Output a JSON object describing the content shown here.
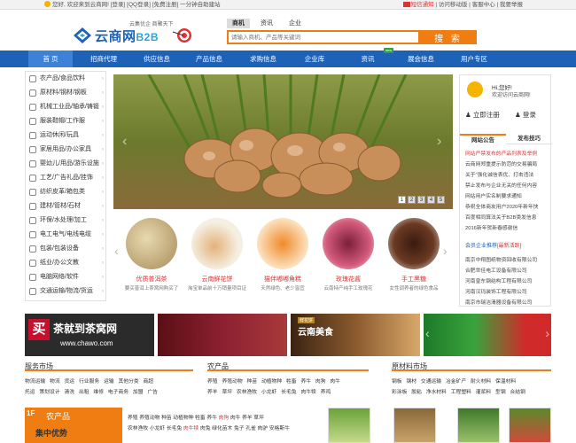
{
  "topbar": {
    "greeting": "您好, 欢迎来到云商网!",
    "login": "[登录]",
    "qq_login": "[QQ登录]",
    "register": "[免费注册]",
    "promo": "一分钟自助建站",
    "mail": "短信通知",
    "mobile": "访问移动版",
    "service": "客服中心",
    "report": "我要举报"
  },
  "logo": {
    "slogan": "云集优企 商聚天下",
    "name": "云商网",
    "b2b": "B2B"
  },
  "search": {
    "tabs": [
      "商机",
      "资讯",
      "企业"
    ],
    "placeholder": "请输入商机、产品等关键词",
    "button": "搜 索"
  },
  "nav": {
    "items": [
      "首 页",
      "招商代理",
      "供应信息",
      "产品信息",
      "求购信息",
      "企业库",
      "资讯",
      "展会信息",
      "用户专区"
    ],
    "badge": "new"
  },
  "sidebar": {
    "items": [
      "农产品/食品饮料",
      "原材料/钢材/钢板",
      "机械工业品/轴承/铸锻",
      "服装鞋帽/工作服",
      "运动休闲/玩具",
      "家居用品/办公家具",
      "婴幼儿/用品/游乐设施",
      "工艺/广告礼品/挂饰",
      "纺织皮革/箱包类",
      "建材/管材/石材",
      "环保/水处理/加工",
      "电工电气/电线电缆",
      "包装/包装设备",
      "纸业/办公文教",
      "电脑网络/软件",
      "交通运输/物流/货运"
    ]
  },
  "banner": {
    "pages": [
      "1",
      "2",
      "3",
      "4",
      "5"
    ],
    "active_page": "1"
  },
  "products": [
    {
      "title": "优质普洱茶",
      "desc": "要买普洱上茶窝网购买了"
    },
    {
      "title": "云南鲜花饼",
      "desc": "淘宝单品前十万销量项目证"
    },
    {
      "title": "猫伴嘟嘟角糕",
      "desc": "天然绿色、老少皆宜"
    },
    {
      "title": "玫瑰花酱",
      "desc": "云南特产纯手工玫瑰花"
    },
    {
      "title": "手工黑糖",
      "desc": "女性调养者的绿色食品"
    }
  ],
  "right": {
    "hi": "Hi,您好!",
    "welcome": "欢迎访问云商网!",
    "register": "立即注册",
    "login": "登录",
    "tabs": [
      "网站公告",
      "发布技巧"
    ],
    "notices": [
      "网站严禁发布的产品列表及举例",
      "云商网郑重提示防范的交易骗局",
      "关于“强化诚信表优、打击违法",
      "禁止发布与企业无关的任何内容",
      "网站用户实名制要求通知",
      "恭祝全体商友用户2020年新年快",
      "百度相同算法关于B2B类发信息",
      "2016新年贺新春感谢信"
    ],
    "recommend_label": "会员企业推荐",
    "recommend_tag": "[最新活跃]",
    "companies": [
      "南京中翔图纸物资回收有限公司",
      "合肥世佳电工设备有限公司",
      "河南皇东钢结构工程有限公司",
      "河南汉玛装饰工程有限公司",
      "南京市瑞洁清器设备有限公司",
      "临沂市富洁净化设备有限公司"
    ]
  },
  "ads": {
    "chawo_text": "茶就到茶窝网",
    "chawo_url": "www.chawo.com",
    "yunnan": "云南美食",
    "yunnan_tag": "鲜花饼"
  },
  "sections": {
    "service": {
      "title": "服务市场",
      "rows": [
        [
          "物流运输",
          "物流",
          "货运",
          "行业服务",
          "运输",
          "其他分类",
          "商超"
        ],
        [
          "托运",
          "策划设计",
          "清洗",
          "出租",
          "维修",
          "电子商务",
          "加盟",
          "广告"
        ]
      ]
    },
    "agri": {
      "title": "农产品",
      "rows": [
        [
          "养殖",
          "养殖动物",
          "种苗",
          "动植物种",
          "牲畜",
          "养牛",
          "肉狗",
          "肉牛"
        ],
        [
          "养羊",
          "草坪",
          "农林渔牧",
          "小龙虾",
          "长毛兔",
          "肉牛犊",
          "养鸡"
        ]
      ]
    },
    "material": {
      "title": "原材料市场",
      "rows": [
        [
          "钢板",
          "钢材",
          "交通运输",
          "冶金矿产",
          "耐火材料",
          "保温材料"
        ],
        [
          "彩涂板",
          "胶粘",
          "净水材料",
          "工程塑料",
          "灌浆料",
          "型钢",
          "合结钢"
        ]
      ]
    }
  },
  "floor": {
    "num": "1F",
    "name": "农产品",
    "sub": "集中优势",
    "links_row1": [
      "养殖",
      "养殖动物",
      "种苗",
      "动植物种",
      "牲畜",
      "养牛",
      "肉狗",
      "肉牛",
      "养羊",
      "草坪"
    ],
    "links_row2": [
      "农林渔牧",
      "小龙虾",
      "长毛兔",
      "肉牛犊",
      "肉兔",
      "绿化苗木",
      "兔子",
      "孔雀",
      "肉驴",
      "安格斯牛"
    ],
    "hot_item": "肉狗",
    "hot_item2": "肉牛犊"
  },
  "colors": {
    "brand_blue": "#1e62b8",
    "accent_orange": "#ef7d12",
    "highlight_red": "#dd3333"
  }
}
